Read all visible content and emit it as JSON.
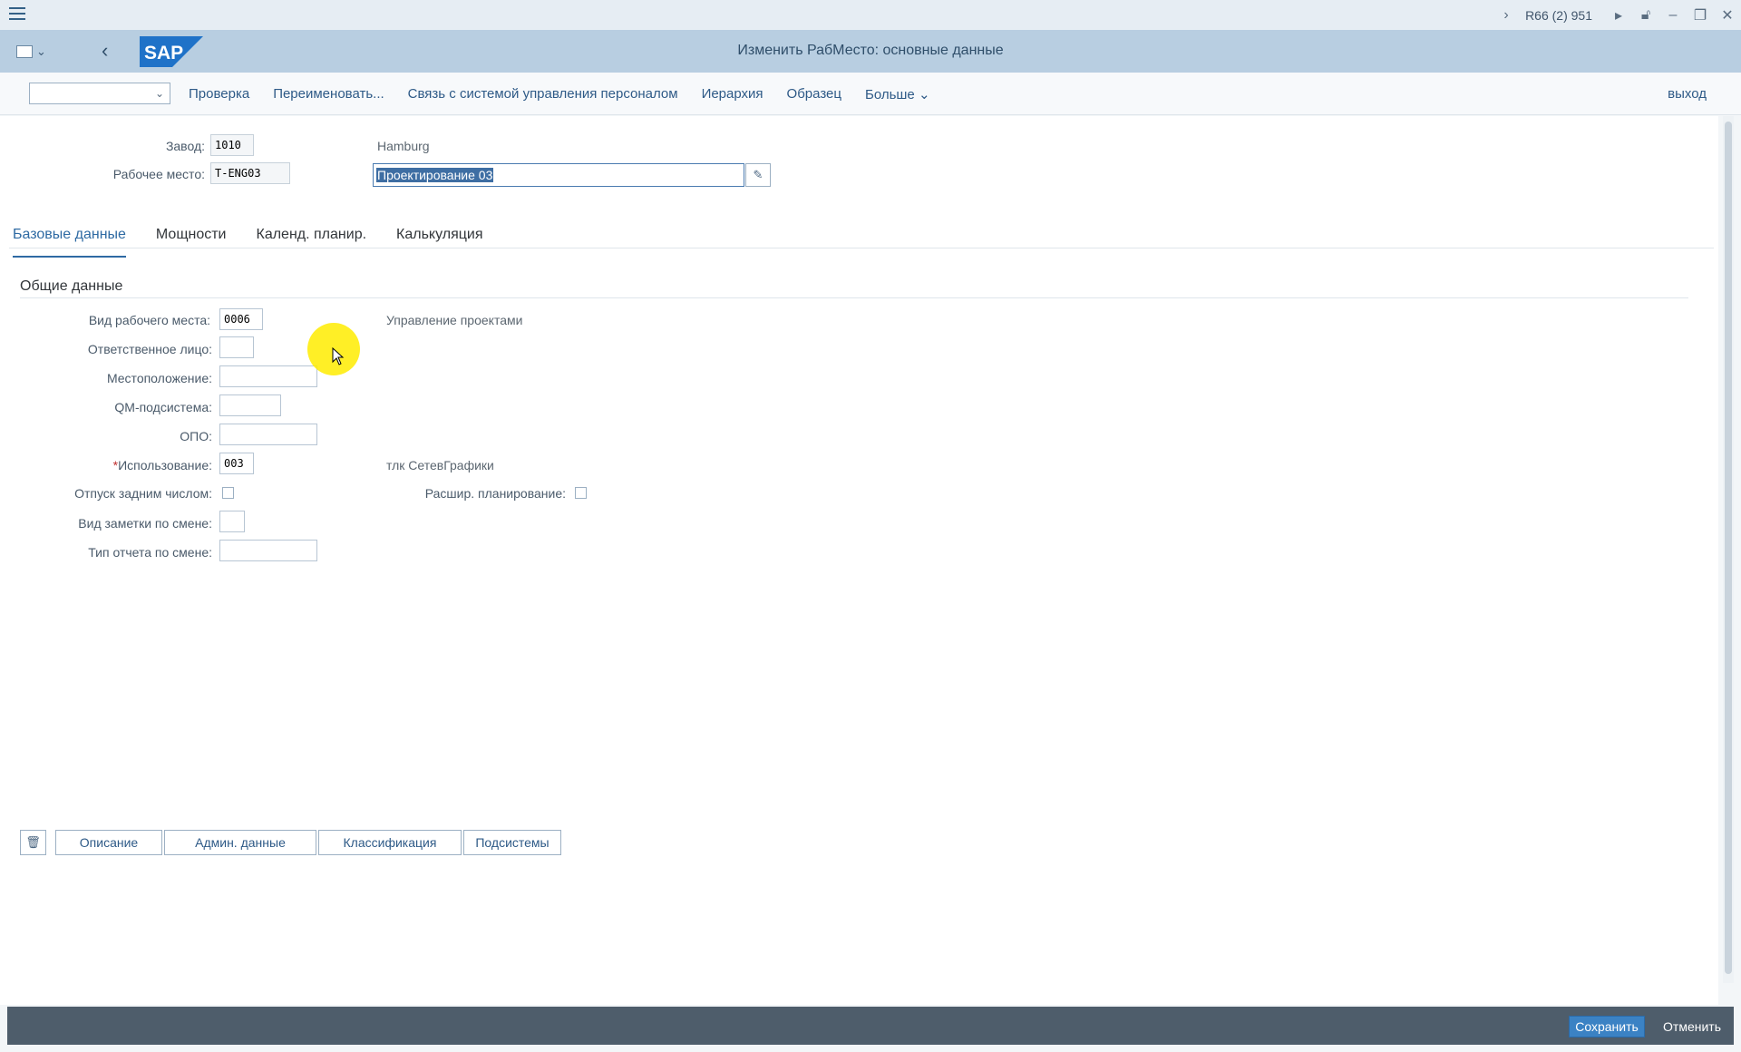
{
  "system": {
    "id_label": "R66 (2) 951"
  },
  "header": {
    "logo_text": "SAP",
    "title": "Изменить РабМесто: основные данные"
  },
  "toolbar": {
    "items": [
      "Проверка",
      "Переименовать...",
      "Связь с системой управления персоналом",
      "Иерархия",
      "Образец",
      "Больше"
    ],
    "exit": "выход"
  },
  "header_fields": {
    "plant_label": "Завод:",
    "plant_value": "1010",
    "plant_text": "Hamburg",
    "workcenter_label": "Рабочее место:",
    "workcenter_value": "T-ENG03",
    "description_value": "Проектирование 03"
  },
  "tabs": [
    "Базовые данные",
    "Мощности",
    "Календ. планир.",
    "Калькуляция"
  ],
  "general": {
    "title": "Общие данные",
    "wc_category_label": "Вид рабочего места:",
    "wc_category_value": "0006",
    "wc_category_text": "Управление проектами",
    "responsible_label": "Ответственное лицо:",
    "responsible_value": "",
    "location_label": "Местоположение:",
    "location_value": "",
    "qm_label": "QM-подсистема:",
    "qm_value": "",
    "opo_label": "ОПО:",
    "opo_value": "",
    "usage_required_mark": "*",
    "usage_label": "Использование:",
    "usage_value": "003",
    "usage_text": "тлк СетевГрафики",
    "backflush_label": "Отпуск задним числом:",
    "adv_planning_label": "Расшир. планирование:",
    "shift_note_label": "Вид заметки по смене:",
    "shift_note_value": "",
    "shift_report_label": "Тип отчета по смене:",
    "shift_report_value": ""
  },
  "bottom_buttons": [
    "Описание",
    "Админ. данные",
    "Классификация",
    "Подсистемы"
  ],
  "footer": {
    "save": "Сохранить",
    "cancel": "Отменить"
  }
}
